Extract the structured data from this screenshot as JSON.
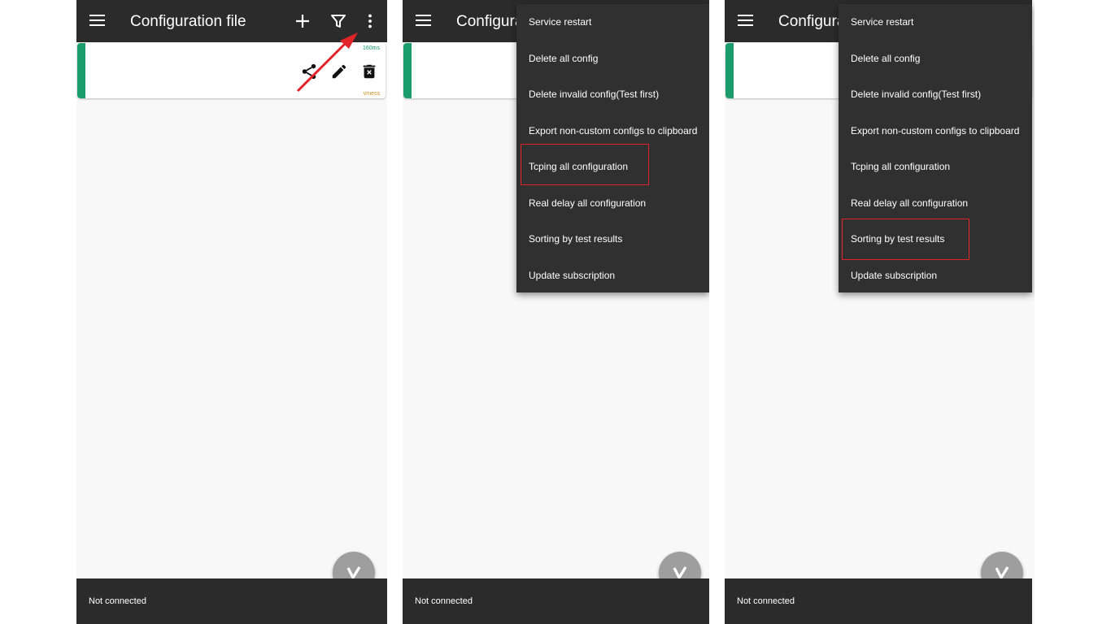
{
  "screens": [
    {
      "title": "Configuration file",
      "card": {
        "latency": "160ms",
        "type": "vmess"
      },
      "status": "Not connected"
    },
    {
      "title": "Configura",
      "status": "Not connected",
      "menu": {
        "items": [
          "Service restart",
          "Delete all config",
          "Delete invalid config(Test first)",
          "Export non-custom configs to clipboard",
          "Tcping all configuration",
          "Real delay all configuration",
          "Sorting by test results",
          "Update subscription"
        ],
        "highlighted": "Tcping all configuration"
      }
    },
    {
      "title": "Configura",
      "status": "Not connected",
      "menu": {
        "items": [
          "Service restart",
          "Delete all config",
          "Delete invalid config(Test first)",
          "Export non-custom configs to clipboard",
          "Tcping all configuration",
          "Real delay all configuration",
          "Sorting by test results",
          "Update subscription"
        ],
        "highlighted": "Sorting by test results"
      }
    }
  ],
  "icons": {
    "menu": "hamburger-menu-icon",
    "add": "plus-icon",
    "filter": "filter-icon",
    "overflow": "more-vert-icon",
    "share": "share-icon",
    "edit": "edit-pencil-icon",
    "delete": "delete-trash-icon",
    "fab": "v2ray-v-icon"
  },
  "colors": {
    "appbar": "#2b2b2b",
    "menu": "#303030",
    "accent": "#1a9c6c",
    "type_label": "#d0901b",
    "highlight_box": "#e0242a",
    "arrow": "#e0242a",
    "fab": "#9e9e9e"
  }
}
